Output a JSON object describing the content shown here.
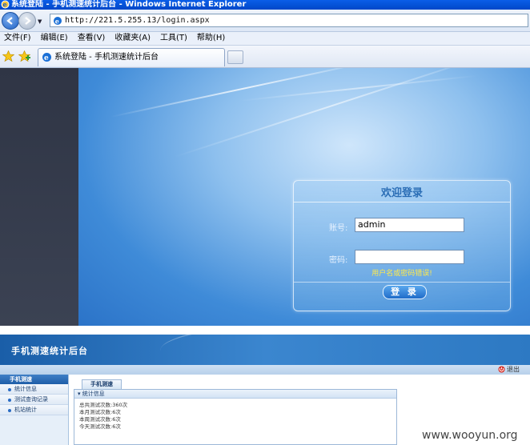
{
  "window": {
    "title": "系统登陆 - 手机测速统计后台 - Windows Internet Explorer",
    "url": "http://221.5.255.13/login.aspx"
  },
  "menu": [
    "文件(F)",
    "编辑(E)",
    "查看(V)",
    "收藏夹(A)",
    "工具(T)",
    "帮助(H)"
  ],
  "tab": {
    "label": "系统登陆 - 手机测速统计后台"
  },
  "login": {
    "title": "欢迎登录",
    "username_label": "账号:",
    "username_value": "admin",
    "password_label": "密码:",
    "password_value": "",
    "error": "用户名或密码错误!",
    "button": "登 录"
  },
  "admin": {
    "title": "手机测速统计后台",
    "logout": "退出",
    "sidebar_head": "手机测速",
    "sidebar_items": [
      "统计信息",
      "测试查询记录",
      "机站统计"
    ],
    "content_tab": "手机测速",
    "box_head": "统计信息",
    "stats": [
      "总共测试次数:360次",
      "本月测试次数:6次",
      "本周测试次数:6次",
      "今天测试次数:6次"
    ]
  },
  "watermark": "www.wooyun.org",
  "colors": {
    "ie_title": "#0a5ee8",
    "login_bg": "#3f8bd8",
    "error_text": "#ffe94a",
    "admin_header": "#2d79c3"
  },
  "icons": [
    "ie-logo-icon",
    "back-arrow-icon",
    "forward-arrow-icon",
    "favorites-star-icon",
    "add-favorite-icon",
    "page-icon",
    "power-icon"
  ]
}
